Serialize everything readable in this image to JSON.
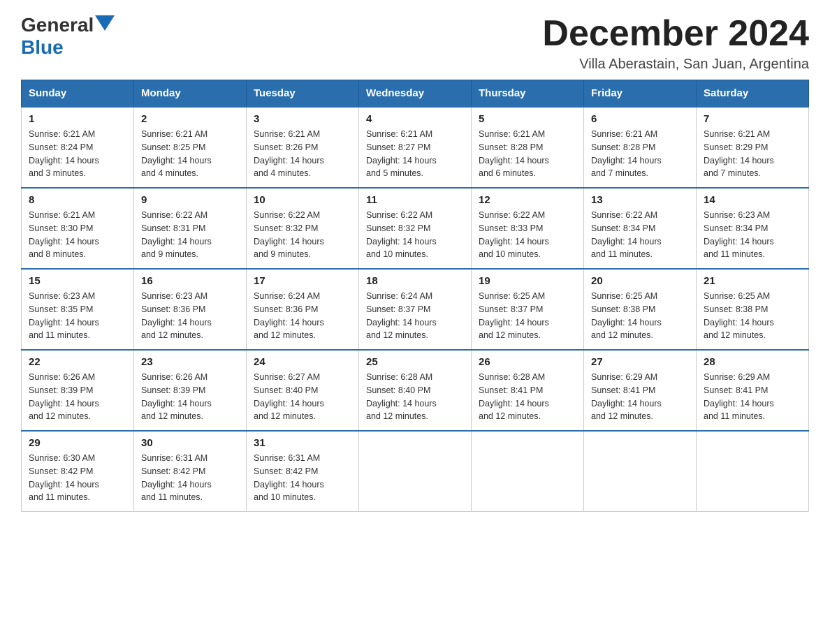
{
  "logo": {
    "text_general": "General",
    "text_blue": "Blue"
  },
  "header": {
    "month_title": "December 2024",
    "subtitle": "Villa Aberastain, San Juan, Argentina"
  },
  "days_of_week": [
    "Sunday",
    "Monday",
    "Tuesday",
    "Wednesday",
    "Thursday",
    "Friday",
    "Saturday"
  ],
  "weeks": [
    [
      {
        "day": "1",
        "sunrise": "6:21 AM",
        "sunset": "8:24 PM",
        "daylight": "14 hours and 3 minutes."
      },
      {
        "day": "2",
        "sunrise": "6:21 AM",
        "sunset": "8:25 PM",
        "daylight": "14 hours and 4 minutes."
      },
      {
        "day": "3",
        "sunrise": "6:21 AM",
        "sunset": "8:26 PM",
        "daylight": "14 hours and 4 minutes."
      },
      {
        "day": "4",
        "sunrise": "6:21 AM",
        "sunset": "8:27 PM",
        "daylight": "14 hours and 5 minutes."
      },
      {
        "day": "5",
        "sunrise": "6:21 AM",
        "sunset": "8:28 PM",
        "daylight": "14 hours and 6 minutes."
      },
      {
        "day": "6",
        "sunrise": "6:21 AM",
        "sunset": "8:28 PM",
        "daylight": "14 hours and 7 minutes."
      },
      {
        "day": "7",
        "sunrise": "6:21 AM",
        "sunset": "8:29 PM",
        "daylight": "14 hours and 7 minutes."
      }
    ],
    [
      {
        "day": "8",
        "sunrise": "6:21 AM",
        "sunset": "8:30 PM",
        "daylight": "14 hours and 8 minutes."
      },
      {
        "day": "9",
        "sunrise": "6:22 AM",
        "sunset": "8:31 PM",
        "daylight": "14 hours and 9 minutes."
      },
      {
        "day": "10",
        "sunrise": "6:22 AM",
        "sunset": "8:32 PM",
        "daylight": "14 hours and 9 minutes."
      },
      {
        "day": "11",
        "sunrise": "6:22 AM",
        "sunset": "8:32 PM",
        "daylight": "14 hours and 10 minutes."
      },
      {
        "day": "12",
        "sunrise": "6:22 AM",
        "sunset": "8:33 PM",
        "daylight": "14 hours and 10 minutes."
      },
      {
        "day": "13",
        "sunrise": "6:22 AM",
        "sunset": "8:34 PM",
        "daylight": "14 hours and 11 minutes."
      },
      {
        "day": "14",
        "sunrise": "6:23 AM",
        "sunset": "8:34 PM",
        "daylight": "14 hours and 11 minutes."
      }
    ],
    [
      {
        "day": "15",
        "sunrise": "6:23 AM",
        "sunset": "8:35 PM",
        "daylight": "14 hours and 11 minutes."
      },
      {
        "day": "16",
        "sunrise": "6:23 AM",
        "sunset": "8:36 PM",
        "daylight": "14 hours and 12 minutes."
      },
      {
        "day": "17",
        "sunrise": "6:24 AM",
        "sunset": "8:36 PM",
        "daylight": "14 hours and 12 minutes."
      },
      {
        "day": "18",
        "sunrise": "6:24 AM",
        "sunset": "8:37 PM",
        "daylight": "14 hours and 12 minutes."
      },
      {
        "day": "19",
        "sunrise": "6:25 AM",
        "sunset": "8:37 PM",
        "daylight": "14 hours and 12 minutes."
      },
      {
        "day": "20",
        "sunrise": "6:25 AM",
        "sunset": "8:38 PM",
        "daylight": "14 hours and 12 minutes."
      },
      {
        "day": "21",
        "sunrise": "6:25 AM",
        "sunset": "8:38 PM",
        "daylight": "14 hours and 12 minutes."
      }
    ],
    [
      {
        "day": "22",
        "sunrise": "6:26 AM",
        "sunset": "8:39 PM",
        "daylight": "14 hours and 12 minutes."
      },
      {
        "day": "23",
        "sunrise": "6:26 AM",
        "sunset": "8:39 PM",
        "daylight": "14 hours and 12 minutes."
      },
      {
        "day": "24",
        "sunrise": "6:27 AM",
        "sunset": "8:40 PM",
        "daylight": "14 hours and 12 minutes."
      },
      {
        "day": "25",
        "sunrise": "6:28 AM",
        "sunset": "8:40 PM",
        "daylight": "14 hours and 12 minutes."
      },
      {
        "day": "26",
        "sunrise": "6:28 AM",
        "sunset": "8:41 PM",
        "daylight": "14 hours and 12 minutes."
      },
      {
        "day": "27",
        "sunrise": "6:29 AM",
        "sunset": "8:41 PM",
        "daylight": "14 hours and 12 minutes."
      },
      {
        "day": "28",
        "sunrise": "6:29 AM",
        "sunset": "8:41 PM",
        "daylight": "14 hours and 11 minutes."
      }
    ],
    [
      {
        "day": "29",
        "sunrise": "6:30 AM",
        "sunset": "8:42 PM",
        "daylight": "14 hours and 11 minutes."
      },
      {
        "day": "30",
        "sunrise": "6:31 AM",
        "sunset": "8:42 PM",
        "daylight": "14 hours and 11 minutes."
      },
      {
        "day": "31",
        "sunrise": "6:31 AM",
        "sunset": "8:42 PM",
        "daylight": "14 hours and 10 minutes."
      },
      null,
      null,
      null,
      null
    ]
  ],
  "labels": {
    "sunrise": "Sunrise:",
    "sunset": "Sunset:",
    "daylight": "Daylight:"
  }
}
